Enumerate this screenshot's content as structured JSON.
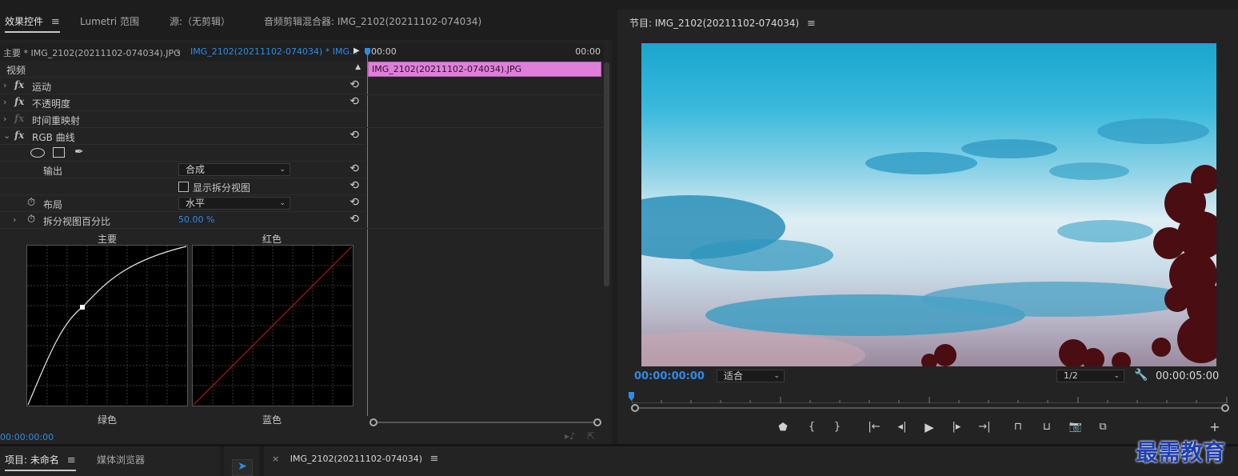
{
  "top_tabs": {
    "effects": "效果控件",
    "lumetri": "Lumetri 范围",
    "source": "源:（无剪辑）",
    "audio_mixer": "音频剪辑混合器: IMG_2102(20211102-074034)",
    "menu_glyph": "≡"
  },
  "clip_selector": {
    "master": "主要 * IMG_2102(20211102-074034).JPG",
    "sequence": "IMG_2102(20211102-074034) * IMG..."
  },
  "timeline": {
    "start": "00:00",
    "end": "00:00",
    "clip_name": "IMG_2102(20211102-074034).JPG",
    "clip_color": "#e07fdb"
  },
  "effects": {
    "section": "视频",
    "motion": "运动",
    "opacity": "不透明度",
    "time_remap": "时间重映射",
    "rgb_curves": "RGB 曲线",
    "output_label": "输出",
    "output_value": "合成",
    "split_view_label": "显示拆分视图",
    "layout_label": "布局",
    "layout_value": "水平",
    "split_percent_label": "拆分视图百分比",
    "split_percent_value": "50.00 %",
    "fx_glyph": "fx",
    "reset_glyph": "⟲"
  },
  "curves": {
    "master": "主要",
    "red": "红色",
    "green": "绿色",
    "blue": "蓝色"
  },
  "effects_timecode": "00:00:00:00",
  "program": {
    "title": "节目: IMG_2102(20211102-074034)",
    "timecode": "00:00:00:00",
    "fit": "适合",
    "resolution": "1/2",
    "duration": "00:00:05:00"
  },
  "bottom": {
    "project": "项目: 未命名",
    "media_browser": "媒体浏览器",
    "sequence_tab": "IMG_2102(20211102-074034)",
    "close_glyph": "×"
  },
  "watermark": "最需教育",
  "colors": {
    "accent": "#2d8ceb",
    "panel": "#232323",
    "background": "#1d1d1d"
  }
}
